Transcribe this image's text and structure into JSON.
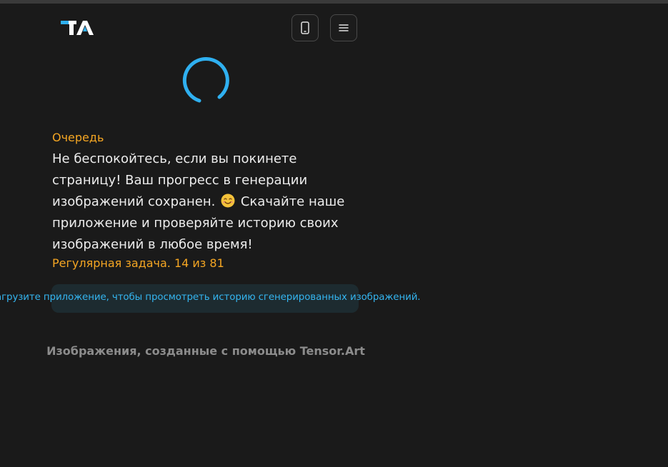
{
  "header": {
    "logo_text": "TA",
    "app_button_icon": "mobile-phone-icon",
    "menu_button_icon": "hamburger-menu-icon"
  },
  "status": {
    "spinner_color": "#2fb0f0",
    "queue_label": "Очередь",
    "message_part1": "Не беспокойтесь, если вы покинете страницу! Ваш прогресс в генерации изображений сохранен.",
    "emoji": "smiling-face-icon",
    "message_part2": "Скачайте наше приложение и проверяйте историю своих изображений в любое время!",
    "task_status": "Регулярная задача. 14 из 81"
  },
  "banner": {
    "text": "агрузите приложение, чтобы просмотреть историю сгенерированных изображений."
  },
  "footer": {
    "caption": "Изображения, созданные с помощью Tensor.Art"
  },
  "colors": {
    "accent_orange": "#f5a623",
    "accent_blue": "#34b5f0",
    "background": "#1a1a1a"
  }
}
